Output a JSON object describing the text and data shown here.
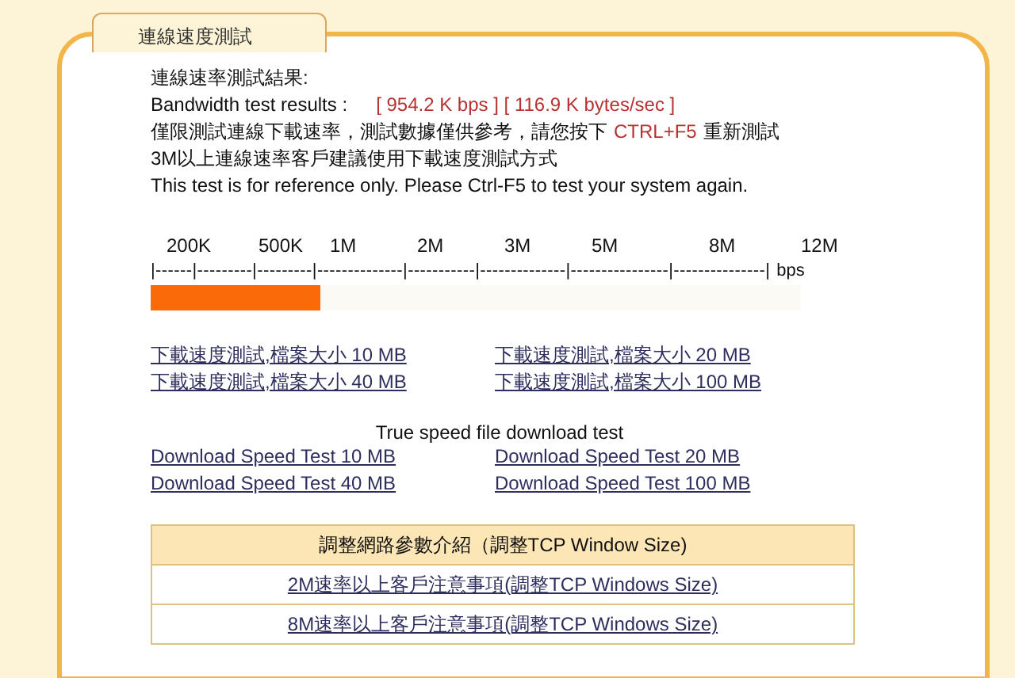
{
  "tab": {
    "title": "連線速度測試"
  },
  "results": {
    "heading": "連線速率測試結果:",
    "label": "Bandwidth test results :",
    "value": "[ 954.2 K bps ] [ 116.9 K bytes/sec ]"
  },
  "notes": {
    "zh_before": "僅限測試連線下載速率，測試數據僅供參考，請您按下",
    "zh_key": "CTRL+F5",
    "zh_after": "重新測試",
    "zh_line2": "3M以上連線速率客戶建議使用下載速度測試方式",
    "en_line": "This test is for reference only. Please Ctrl-F5 to test your system again."
  },
  "scale": {
    "ticks": [
      "200K",
      "500K",
      "1M",
      "2M",
      "3M",
      "5M",
      "8M",
      "12M"
    ],
    "ruler": "|------|---------|---------|--------------|-----------|--------------|----------------|---------------|",
    "unit": "bps",
    "level": 0.26
  },
  "zh_links": [
    "下載速度測試,檔案大小 10 MB",
    "下載速度測試,檔案大小 20 MB",
    "下載速度測試,檔案大小 40 MB",
    "下載速度測試,檔案大小 100 MB"
  ],
  "en_heading": "True speed file download test",
  "en_links": [
    "Download Speed Test 10 MB",
    "Download Speed Test 20 MB",
    "Download Speed Test 40 MB",
    "Download Speed Test 100 MB"
  ],
  "tcp_table": {
    "header": "調整網路參數介紹（調整TCP Window Size)",
    "rows": [
      "2M速率以上客戶注意事項(調整TCP Windows Size)",
      "8M速率以上客戶注意事項(調整TCP Windows Size)"
    ]
  }
}
